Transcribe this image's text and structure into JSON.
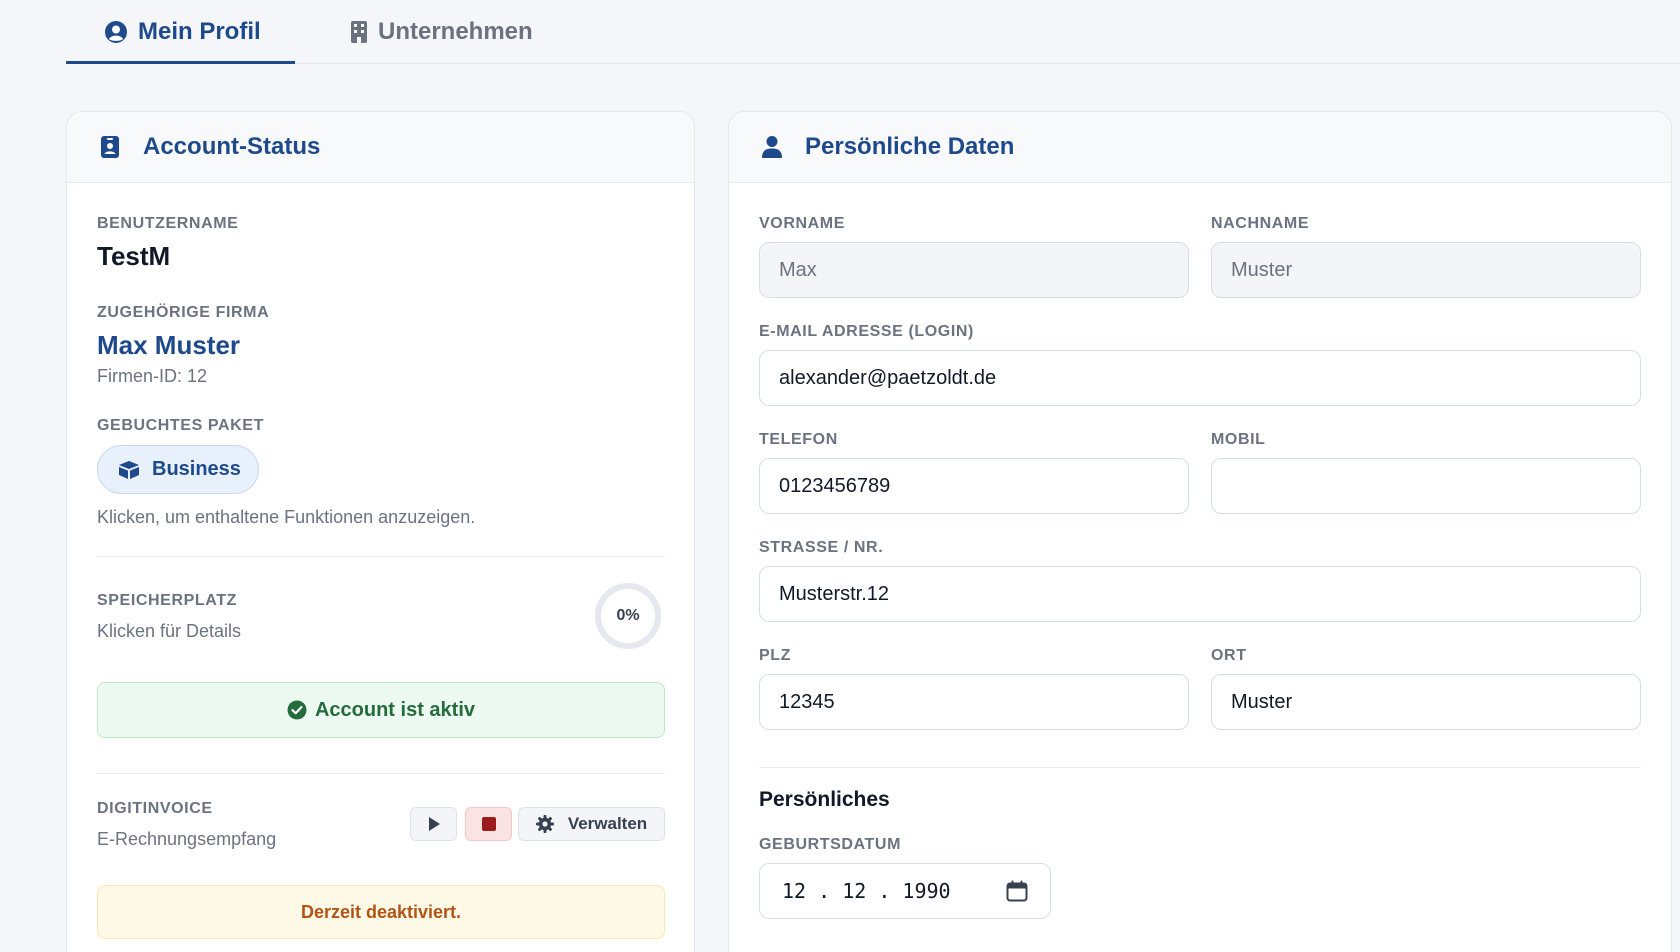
{
  "tabs": {
    "profile": "Mein Profil",
    "company": "Unternehmen"
  },
  "account": {
    "title": "Account-Status",
    "username_label": "Benutzername",
    "username": "TestM",
    "company_label": "Zugehörige Firma",
    "company_name": "Max Muster",
    "company_id": "Firmen-ID: 12",
    "package_label": "Gebuchtes Paket",
    "package_name": "Business",
    "package_hint": "Klicken, um enthaltene Funktionen anzuzeigen.",
    "storage_label": "Speicherplatz",
    "storage_hint": "Klicken für Details",
    "storage_percent": "0%",
    "active_status": "Account ist aktiv",
    "digitinvoice_label": "DigitInvoice",
    "digitinvoice_sub": "E-Rechnungsempfang",
    "manage_label": "Verwalten",
    "deactivated": "Derzeit deaktiviert."
  },
  "personal": {
    "title": "Persönliche Daten",
    "firstname_label": "Vorname",
    "firstname": "Max",
    "lastname_label": "Nachname",
    "lastname": "Muster",
    "email_label": "E-Mail Adresse (Login)",
    "email": "alexander@paetzoldt.de",
    "phone_label": "Telefon",
    "phone": "0123456789",
    "mobile_label": "Mobil",
    "mobile": "",
    "street_label": "Strasse / Nr.",
    "street": "Musterstr.12",
    "zip_label": "PLZ",
    "zip": "12345",
    "city_label": "Ort",
    "city": "Muster",
    "section_personal": "Persönliches",
    "birthdate_label": "Geburtsdatum",
    "birthdate": "12 . 12 . 1990"
  },
  "colors": {
    "accent": "#1e4a8c",
    "success": "#256c3c",
    "warning": "#b45414"
  }
}
